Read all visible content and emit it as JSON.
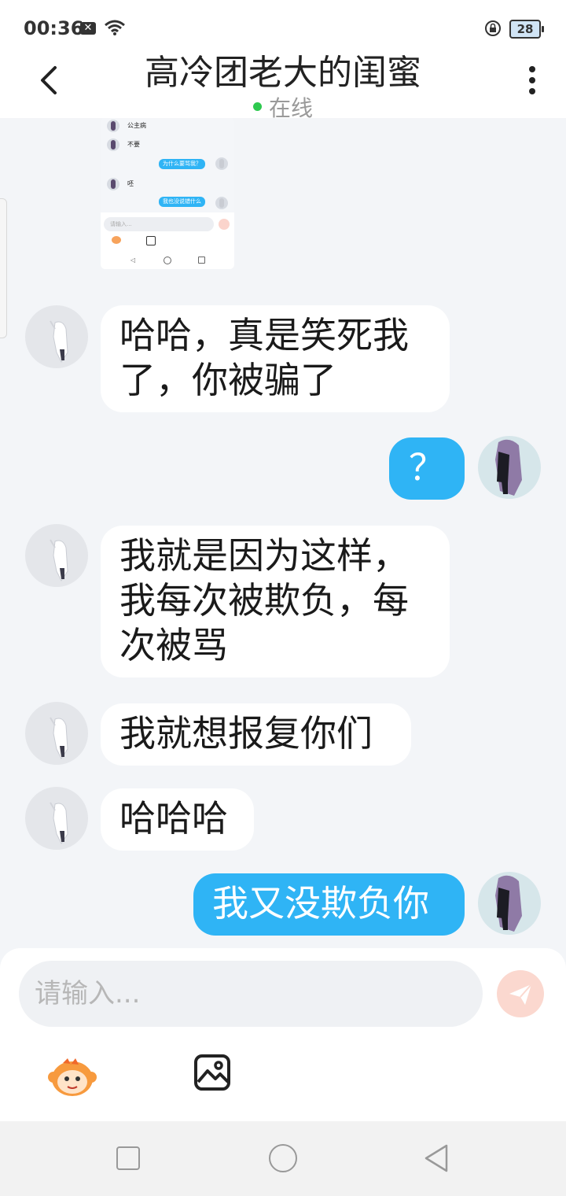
{
  "status_bar": {
    "time": "00:36",
    "notification_icon": "close-box-icon",
    "wifi_icon": "wifi-icon",
    "lock_icon": "rotation-lock-icon",
    "battery_level": "28"
  },
  "header": {
    "title": "高冷团老大的闺蜜",
    "status": "在线",
    "status_color": "#2ec94f",
    "back_icon": "chevron-left-icon",
    "more_icon": "more-vertical-icon"
  },
  "embedded_screenshot": {
    "messages": [
      {
        "side": "in",
        "text": "公主病"
      },
      {
        "side": "in",
        "text": "不要"
      },
      {
        "side": "out",
        "text": "为什么要骂我？"
      },
      {
        "side": "in",
        "text": "呸"
      },
      {
        "side": "out",
        "text": "我也没说错什么"
      }
    ],
    "input_placeholder": "请输入..."
  },
  "messages": [
    {
      "side": "in",
      "text": "哈哈，真是笑死我了，你被骗了"
    },
    {
      "side": "out",
      "text": "？"
    },
    {
      "side": "in",
      "text": "我就是因为这样，我每次被欺负，每次被骂"
    },
    {
      "side": "in",
      "text": "我就想报复你们"
    },
    {
      "side": "in",
      "text": "哈哈哈"
    },
    {
      "side": "out",
      "text": "我又没欺负你"
    }
  ],
  "input": {
    "placeholder": "请输入...",
    "value": "",
    "send_icon": "paper-plane-icon",
    "emoji_icon": "monkey-emoji-icon",
    "image_icon": "image-icon"
  },
  "nav_bar": {
    "recents_icon": "square-icon",
    "home_icon": "circle-icon",
    "back_icon": "triangle-back-icon"
  },
  "colors": {
    "outgoing_bubble": "#2fb4f5",
    "incoming_bubble": "#ffffff",
    "chat_background": "#f3f5f8"
  }
}
